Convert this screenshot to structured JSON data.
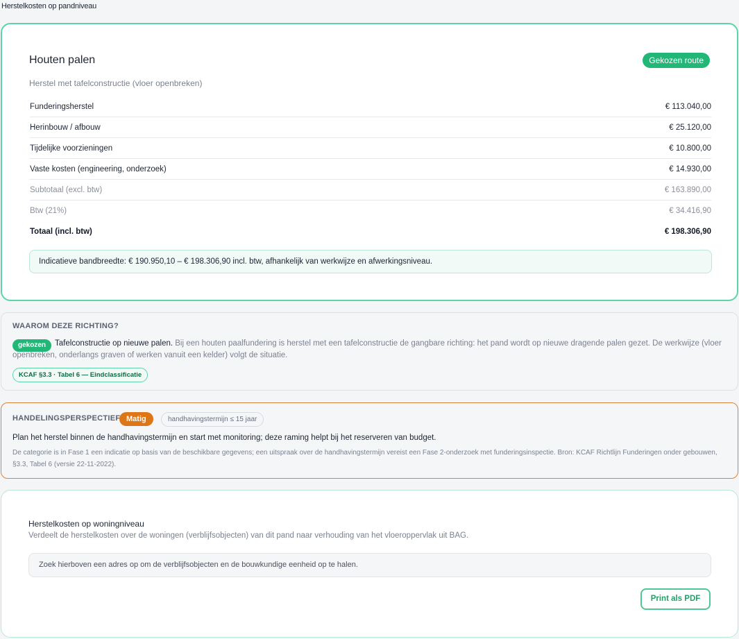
{
  "page": {
    "header": "Herstelkosten op pandniveau"
  },
  "cost_card": {
    "title": "Houten palen",
    "route_badge": "Gekozen route",
    "subtitle": "Herstel met tafelconstructie (vloer openbreken)",
    "rows": [
      {
        "label": "Funderingsherstel",
        "value": "€ 113.040,00"
      },
      {
        "label": "Herinbouw / afbouw",
        "value": "€ 25.120,00"
      },
      {
        "label": "Tijdelijke voorzieningen",
        "value": "€ 10.800,00"
      },
      {
        "label": "Vaste kosten (engineering, onderzoek)",
        "value": "€ 14.930,00"
      },
      {
        "label": "Subtotaal (excl. btw)",
        "value": "€ 163.890,00"
      },
      {
        "label": "Btw (21%)",
        "value": "€ 34.416,90"
      },
      {
        "label": "Totaal (incl. btw)",
        "value": "€ 198.306,90"
      }
    ],
    "bandwidth_note": "Indicatieve bandbreedte: € 190.950,10 – € 198.306,90 incl. btw, afhankelijk van werkwijze en afwerkingsniveau."
  },
  "why": {
    "heading": "WAAROM DEZE RICHTING?",
    "chosen_badge": "gekozen",
    "lead": "Tafelconstructie op nieuwe palen.",
    "body": " Bij een houten paalfundering is herstel met een tafelconstructie de gangbare richting: het pand wordt op nieuwe dragende palen gezet. De werkwijze (vloer openbreken, onderlangs graven of werken vanuit een kelder) volgt de situatie.",
    "source": "KCAF §3.3 · Tabel 6 — Eindclassificatie"
  },
  "perspective": {
    "heading": "HANDELINGSPERSPECTIEF",
    "severity_badge": "Matig",
    "term_badge": "handhavingstermijn ≤ 15 jaar",
    "main": "Plan het herstel binnen de handhavingstermijn en start met monitoring; deze raming helpt bij het reserveren van budget.",
    "note": "De categorie is in Fase 1 een indicatie op basis van de beschikbare gegevens; een uitspraak over de handhavingstermijn vereist een Fase 2-onderzoek met funderingsinspectie. Bron: KCAF Richtlijn Funderingen onder gebouwen, §3.3, Tabel 6 (versie 22-11-2022)."
  },
  "dwelling": {
    "title": "Herstelkosten op woningniveau",
    "description": "Verdeelt de herstelkosten over de woningen (verblijfsobjecten) van dit pand naar verhouding van het vloeroppervlak uit BAG.",
    "placeholder_text": "Zoek hierboven een adres op om de verblijfsobjecten en de bouwkundige eenheid op te halen.",
    "pdf_button": "Print als PDF"
  },
  "colors": {
    "accent_green": "#22b777",
    "card_border_green": "#5fd3a8",
    "warning_orange": "#dd7616"
  }
}
